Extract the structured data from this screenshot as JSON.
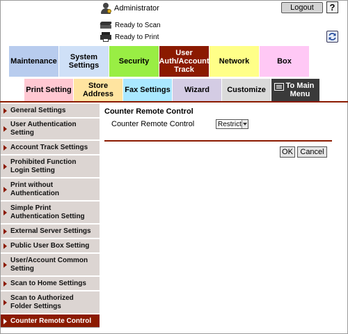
{
  "header": {
    "user_label": "Administrator",
    "logout_label": "Logout",
    "help_label": "?",
    "status_scan": "Ready to Scan",
    "status_print": "Ready to Print"
  },
  "main_tabs": [
    {
      "label": "Maintenance",
      "color": "#b8ccee"
    },
    {
      "label": "System Settings",
      "color": "#cfe0f7"
    },
    {
      "label": "Security",
      "color": "#99ee44"
    },
    {
      "label": "User Auth/Account Track",
      "color": "#8b1a00"
    },
    {
      "label": "Network",
      "color": "#ffff88"
    },
    {
      "label": "Box",
      "color": "#ffc8f5"
    }
  ],
  "sub_tabs": [
    {
      "label": "Print Setting",
      "color": "#ffc8d2"
    },
    {
      "label": "Store Address",
      "color": "#ffe4a0"
    },
    {
      "label": "Fax Settings",
      "color": "#aae8ff"
    },
    {
      "label": "Wizard",
      "color": "#d4cce4"
    },
    {
      "label": "Customize",
      "color": "#dadada"
    },
    {
      "label": "To Main Menu",
      "color": "#3a3a3a"
    }
  ],
  "sidebar": {
    "items": [
      {
        "label": "General Settings"
      },
      {
        "label": "User Authentication Setting"
      },
      {
        "label": "Account Track Settings"
      },
      {
        "label": "Prohibited Function Login Setting"
      },
      {
        "label": "Print without Authentication"
      },
      {
        "label": "Simple Print Authentication Setting"
      },
      {
        "label": "External Server Settings"
      },
      {
        "label": "Public User Box Setting"
      },
      {
        "label": "User/Account Common Setting"
      },
      {
        "label": "Scan to Home Settings"
      },
      {
        "label": "Scan to Authorized Folder Settings"
      },
      {
        "label": "Counter Remote Control"
      }
    ],
    "active_index": 11
  },
  "content": {
    "title": "Counter Remote Control",
    "field_label": "Counter Remote Control",
    "select_value": "Restrict",
    "ok_label": "OK",
    "cancel_label": "Cancel"
  },
  "colors": {
    "accent": "#8b1a00",
    "sidebar_bg": "#dcd5d2"
  }
}
